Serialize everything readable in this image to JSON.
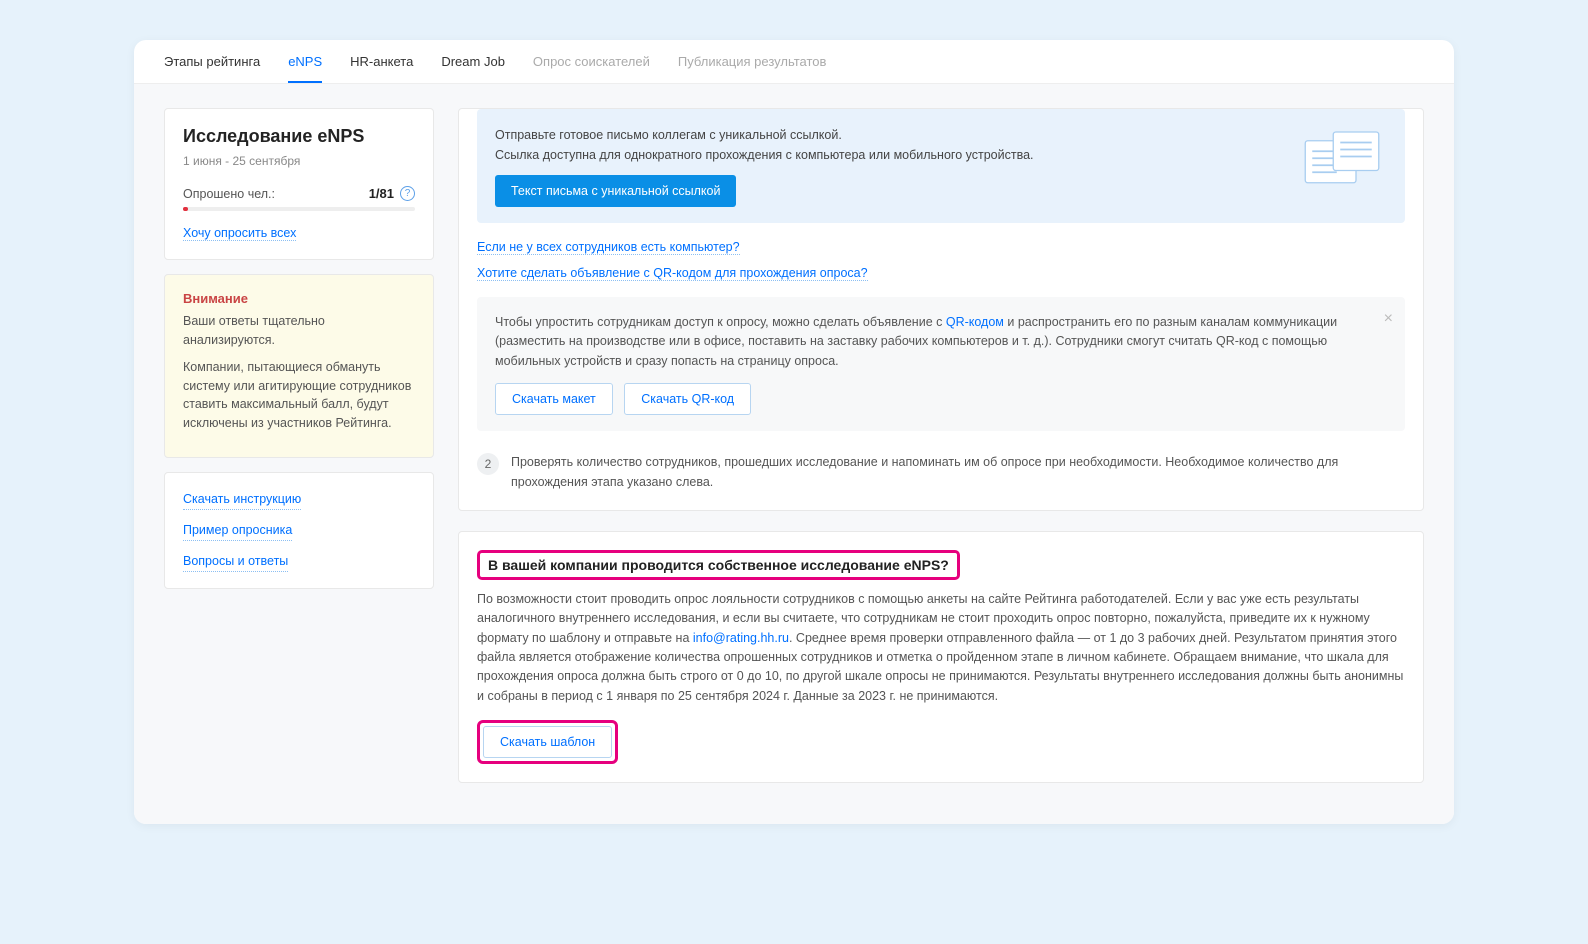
{
  "tabs": {
    "stages": "Этапы рейтинга",
    "enps": "eNPS",
    "hr": "HR-анкета",
    "dreamjob": "Dream Job",
    "applicants": "Опрос соискателей",
    "publication": "Публикация результатов"
  },
  "sidebar": {
    "title": "Исследование eNPS",
    "dates": "1 июня - 25 сентября",
    "stat_label": "Опрошено чел.:",
    "stat_value": "1/81",
    "want_all": "Хочу опросить всех",
    "warn_title": "Внимание",
    "warn_p1": "Ваши ответы тщательно анализируются.",
    "warn_p2": "Компании, пытающиеся обмануть систему или агитирующие сотрудников ставить максимальный балл, будут исключены из участников Рейтинга.",
    "link_instr": "Скачать инструкцию",
    "link_sample": "Пример опросника",
    "link_faq": "Вопросы и ответы"
  },
  "main": {
    "blue_p1": "Отправьте готовое письмо коллегам с уникальной ссылкой.",
    "blue_p2": "Ссылка доступна для однократного прохождения с компьютера или мобильного устройства.",
    "blue_btn": "Текст письма с уникальной ссылкой",
    "link_nocomp": "Если не у всех сотрудников есть компьютер?",
    "link_qr": "Хотите сделать объявление с QR-кодом для прохождения опроса?",
    "gray_pre": "Чтобы упростить сотрудникам доступ к опросу, можно сделать объявление с ",
    "gray_qrlink": "QR-кодом",
    "gray_post": " и распространить его по разным каналам коммуникации (разместить на производстве или в офисе, поставить на заставку рабочих компьютеров и т. д.). Сотрудники смогут считать QR-код с помощью мобильных устройств и сразу попасть на страницу опроса.",
    "btn_layout": "Скачать макет",
    "btn_qr": "Скачать QR-код",
    "step2_num": "2",
    "step2_text": "Проверять количество сотрудников, прошедших исследование и напоминать им об опросе при необходимости. Необходимое количество для прохождения этапа указано слева."
  },
  "own": {
    "title": "В вашей компании проводится собственное исследование eNPS?",
    "body_pre": "По возможности стоит проводить опрос лояльности сотрудников с помощью анкеты на сайте Рейтинга работодателей. Если у вас уже есть результаты аналогичного внутреннего исследования, и если вы считаете, что сотрудникам не стоит проходить опрос повторно, пожалуйста, приведите их к нужному формату по шаблону и отправьте на ",
    "email": "info@rating.hh.ru",
    "body_post": ". Среднее время проверки отправленного файла — от 1 до 3 рабочих дней. Результатом принятия этого файла является отображение количества опрошенных сотрудников и отметка о пройденном этапе в личном кабинете. Обращаем внимание, что шкала для прохождения опроса должна быть строго от 0 до 10, по другой шкале опросы не принимаются. Результаты внутреннего исследования должны быть анонимны и собраны в период с 1 января по 25 сентября 2024 г. Данные за 2023 г. не принимаются.",
    "btn": "Скачать шаблон"
  }
}
